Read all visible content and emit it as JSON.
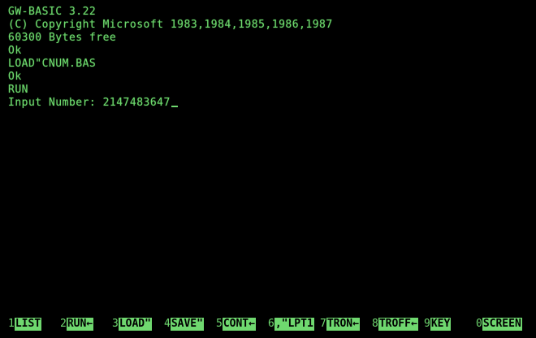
{
  "terminal": {
    "lines": [
      "GW-BASIC 3.22",
      "(C) Copyright Microsoft 1983,1984,1985,1986,1987",
      "60300 Bytes free",
      "Ok",
      "LOAD\"CNUM.BAS",
      "Ok",
      "RUN"
    ],
    "prompt": "Input Number: 2147483647"
  },
  "function_keys": [
    {
      "number": "1",
      "label": "LIST"
    },
    {
      "number": "2",
      "label": "RUN←"
    },
    {
      "number": "3",
      "label": "LOAD\""
    },
    {
      "number": "4",
      "label": "SAVE\""
    },
    {
      "number": "5",
      "label": "CONT←"
    },
    {
      "number": "6",
      "label": ",\"LPT1"
    },
    {
      "number": "7",
      "label": "TRON←"
    },
    {
      "number": "8",
      "label": "TROFF←"
    },
    {
      "number": "9",
      "label": "KEY"
    },
    {
      "number": "0",
      "label": "SCREEN"
    }
  ],
  "colors": {
    "foreground": "#6fd86f",
    "background": "#000000"
  }
}
